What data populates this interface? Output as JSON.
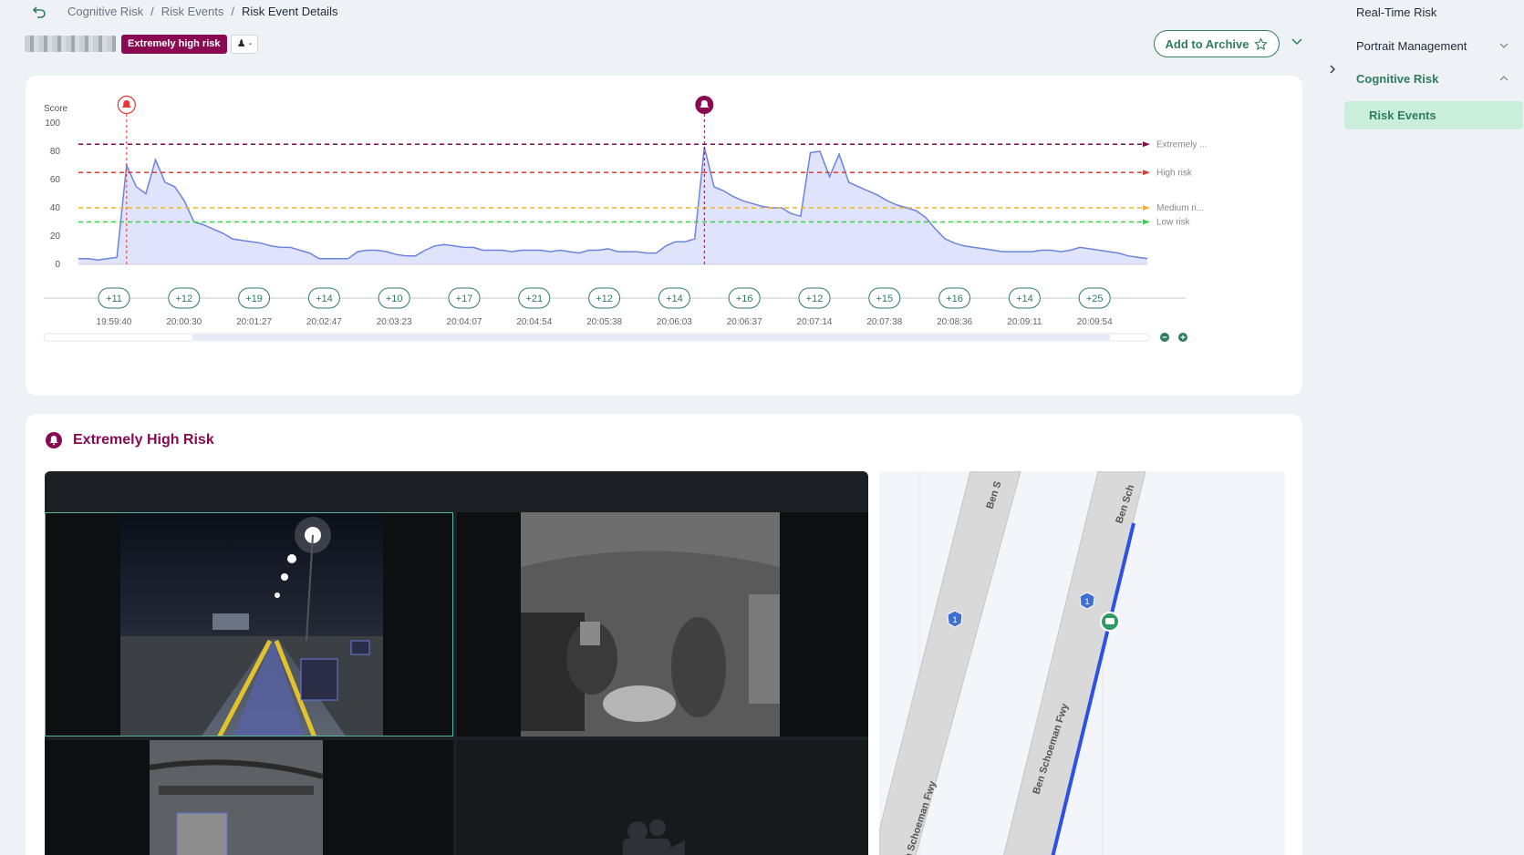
{
  "breadcrumb": {
    "items": [
      "Cognitive Risk",
      "/",
      "Risk Events",
      "/"
    ],
    "current": "Risk Event Details"
  },
  "header": {
    "risk_tag": "Extremely high risk",
    "driver_chip": "-",
    "archive_label": "Add to Archive"
  },
  "sidebar": {
    "items": [
      {
        "label": "Real-Time Risk"
      },
      {
        "label": "Portrait Management"
      },
      {
        "label": "Cognitive Risk"
      }
    ],
    "sub_item": "Risk Events"
  },
  "chart_data": {
    "type": "area",
    "ylabel": "Score",
    "ylim": [
      0,
      100
    ],
    "yticks": [
      0,
      20,
      40,
      60,
      80,
      100
    ],
    "thresholds": [
      {
        "label": "Extremely ...",
        "value": 85,
        "color": "#8a0a52"
      },
      {
        "label": "High risk",
        "value": 65,
        "color": "#e53935"
      },
      {
        "label": "Medium ri...",
        "value": 40,
        "color": "#f0b429"
      },
      {
        "label": "Low risk",
        "value": 30,
        "color": "#3bd04a"
      }
    ],
    "series": [
      {
        "values": [
          4,
          4,
          3,
          4,
          5,
          70,
          55,
          50,
          74,
          58,
          55,
          45,
          30,
          28,
          25,
          22,
          18,
          17,
          16,
          15,
          13,
          12,
          12,
          10,
          8,
          4,
          4,
          4,
          4,
          9,
          10,
          10,
          9,
          7,
          6,
          6,
          10,
          13,
          14,
          13,
          12,
          12,
          10,
          10,
          10,
          9,
          10,
          10,
          10,
          9,
          10,
          9,
          8,
          10,
          10,
          11,
          9,
          9,
          9,
          8,
          8,
          13,
          16,
          16,
          18,
          83,
          55,
          52,
          48,
          45,
          43,
          41,
          40,
          40,
          36,
          34,
          79,
          80,
          62,
          78,
          58,
          55,
          52,
          49,
          45,
          42,
          40,
          38,
          33,
          25,
          18,
          15,
          13,
          12,
          11,
          10,
          9,
          9,
          9,
          9,
          10,
          10,
          9,
          10,
          12,
          11,
          10,
          9,
          8,
          6,
          5,
          4
        ]
      }
    ],
    "event_markers": [
      {
        "index": 5,
        "level": "high"
      },
      {
        "index": 65,
        "level": "extreme"
      }
    ],
    "timeline": [
      {
        "count": "+11",
        "time": "19:59:40"
      },
      {
        "count": "+12",
        "time": "20:00:30"
      },
      {
        "count": "+19",
        "time": "20:01:27"
      },
      {
        "count": "+14",
        "time": "20:02:47"
      },
      {
        "count": "+10",
        "time": "20:03:23"
      },
      {
        "count": "+17",
        "time": "20:04:07"
      },
      {
        "count": "+21",
        "time": "20:04:54"
      },
      {
        "count": "+12",
        "time": "20:05:38"
      },
      {
        "count": "+14",
        "time": "20:06:03"
      },
      {
        "count": "+16",
        "time": "20:06:37"
      },
      {
        "count": "+12",
        "time": "20:07:14"
      },
      {
        "count": "+15",
        "time": "20:07:38"
      },
      {
        "count": "+16",
        "time": "20:08:36"
      },
      {
        "count": "+14",
        "time": "20:09:11"
      },
      {
        "count": "+25",
        "time": "20:09:54"
      }
    ]
  },
  "event": {
    "title": "Extremely High Risk"
  },
  "map": {
    "road_labels": [
      "Ben S",
      "Ben Sch",
      "Ben Schoeman Fwy",
      "Ben Schoeman Fwy"
    ],
    "shields": [
      "1",
      "1"
    ]
  }
}
